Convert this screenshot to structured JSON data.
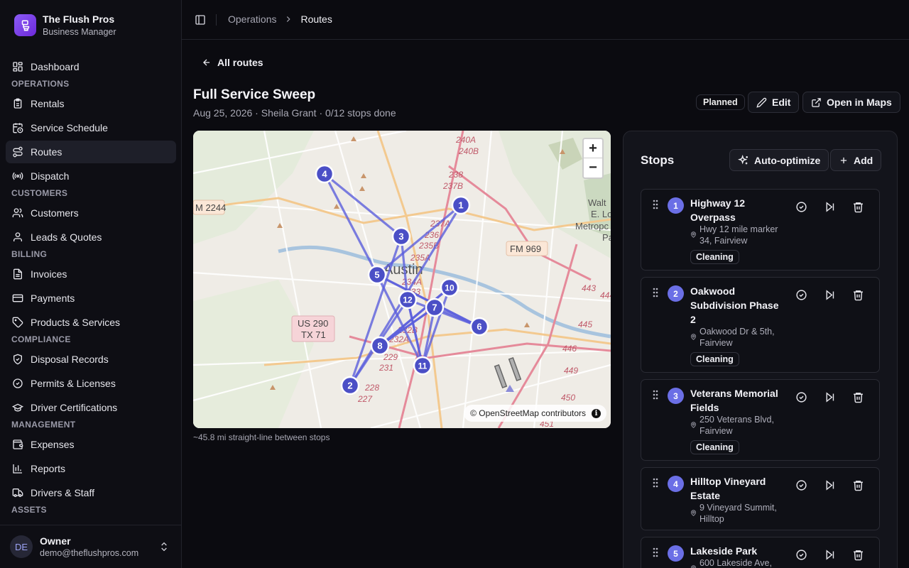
{
  "brand": {
    "name": "The Flush Pros",
    "subtitle": "Business Manager"
  },
  "nav": {
    "dashboard": "Dashboard",
    "operations": {
      "label": "OPERATIONS",
      "rentals": "Rentals",
      "schedule": "Service Schedule",
      "routes": "Routes",
      "dispatch": "Dispatch"
    },
    "customers": {
      "label": "CUSTOMERS",
      "customers": "Customers",
      "leads": "Leads & Quotes"
    },
    "billing": {
      "label": "BILLING",
      "invoices": "Invoices",
      "payments": "Payments",
      "products": "Products & Services"
    },
    "compliance": {
      "label": "COMPLIANCE",
      "disposal": "Disposal Records",
      "permits": "Permits & Licenses",
      "certs": "Driver Certifications"
    },
    "management": {
      "label": "MANAGEMENT",
      "expenses": "Expenses",
      "reports": "Reports",
      "drivers": "Drivers & Staff"
    },
    "assets": {
      "label": "ASSETS"
    }
  },
  "user": {
    "initials": "DE",
    "name": "Owner",
    "email": "demo@theflushpros.com"
  },
  "breadcrumb": {
    "parent": "Operations",
    "current": "Routes"
  },
  "page": {
    "back_label": "All routes",
    "title": "Full Service Sweep",
    "subtitle": "Aug 25, 2026 · Sheila Grant · 0/12 stops done",
    "status": "Planned",
    "edit_label": "Edit",
    "open_maps_label": "Open in Maps"
  },
  "map": {
    "attribution": "© OpenStreetMap contributors",
    "distance_note": "~45.8 mi straight-line between stops",
    "city_label": "Austin",
    "road_labels": {
      "fm2244": "M 2244",
      "fm969": "FM 969",
      "us290": "US 290",
      "tx71": "TX 71"
    },
    "markers": [
      "1",
      "2",
      "3",
      "4",
      "5",
      "6",
      "7",
      "8",
      "10",
      "11",
      "12"
    ]
  },
  "stops_panel": {
    "title": "Stops",
    "auto_optimize_label": "Auto-optimize",
    "add_label": "Add",
    "stops": [
      {
        "number": "1",
        "name": "Highway 12 Overpass",
        "address": "Hwy 12 mile marker 34, Fairview",
        "service": "Cleaning"
      },
      {
        "number": "2",
        "name": "Oakwood Subdivision Phase 2",
        "address": "Oakwood Dr & 5th, Fairview",
        "service": "Cleaning"
      },
      {
        "number": "3",
        "name": "Veterans Memorial Fields",
        "address": "250 Veterans Blvd, Fairview",
        "service": "Cleaning"
      },
      {
        "number": "4",
        "name": "Hilltop Vineyard Estate",
        "address": "9 Vineyard Summit, Hilltop",
        "service": ""
      },
      {
        "number": "5",
        "name": "Lakeside Park",
        "address": "600 Lakeside Ave,",
        "service": ""
      }
    ]
  }
}
